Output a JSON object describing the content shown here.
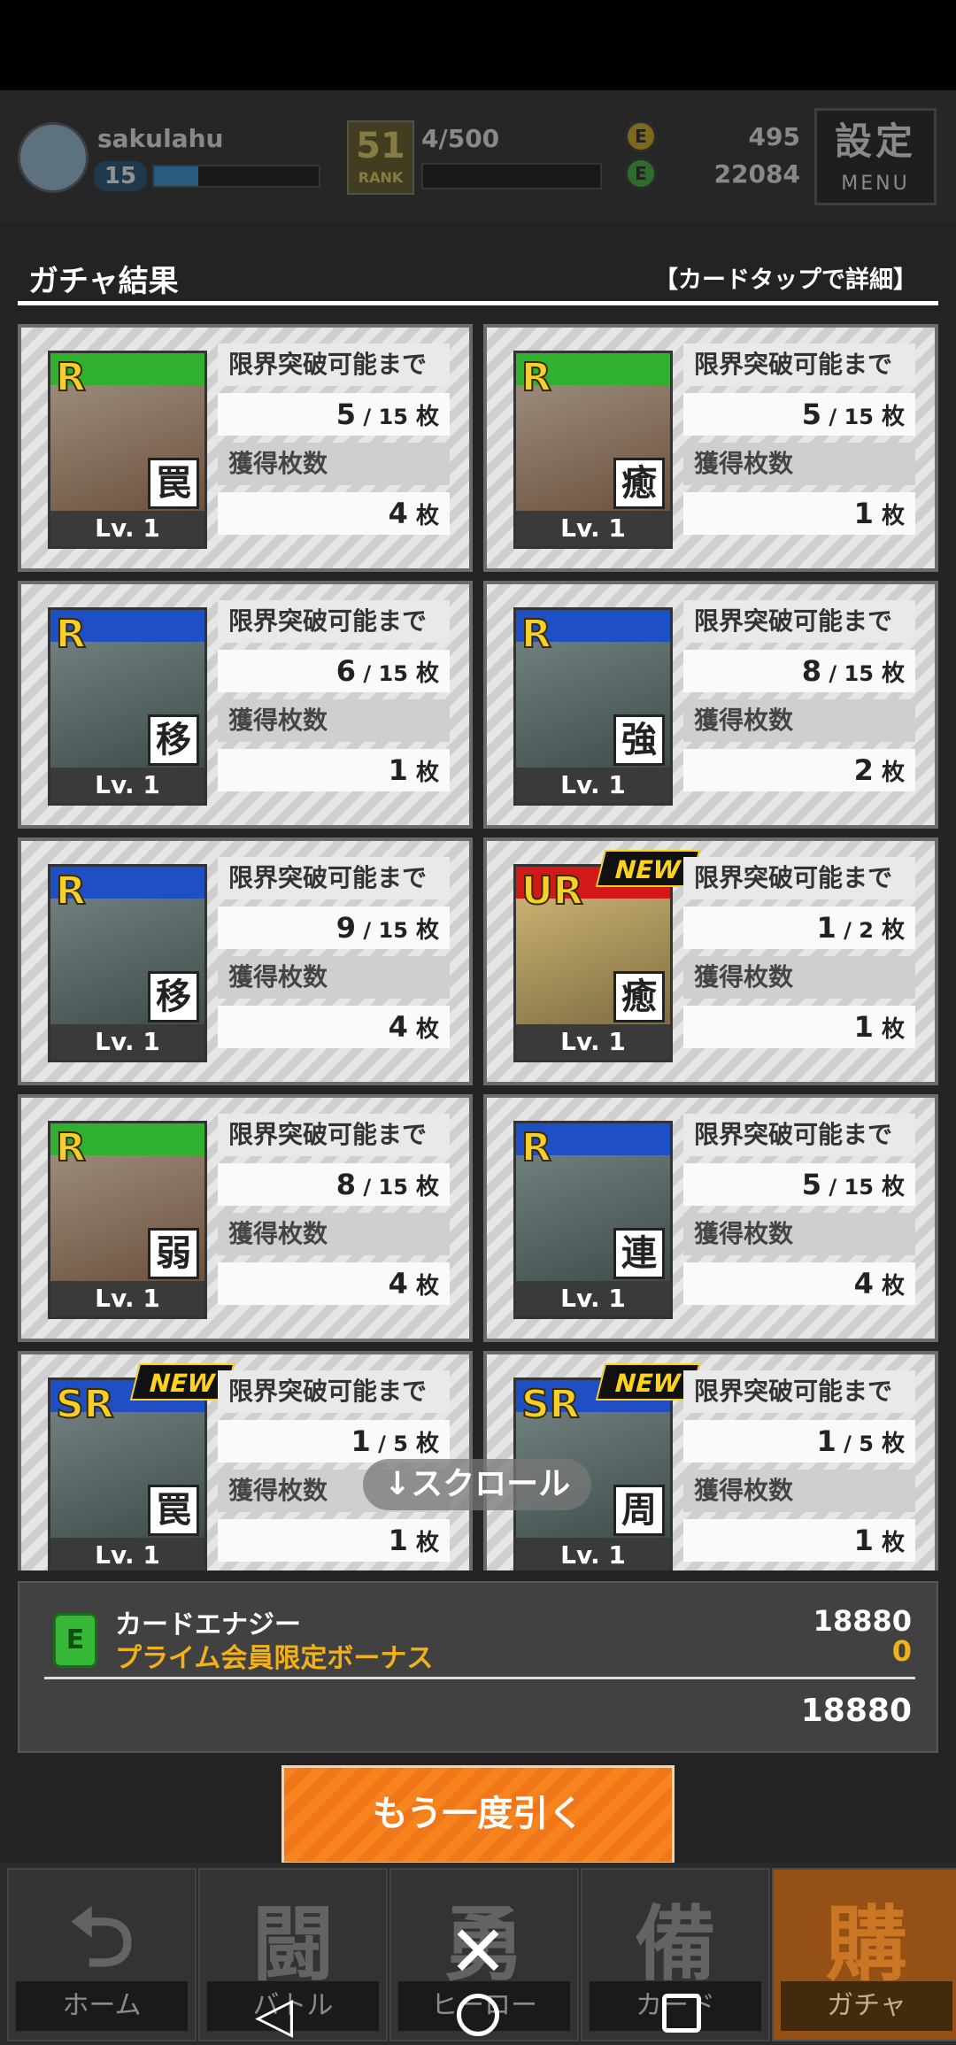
{
  "header": {
    "username": "sakulahu",
    "level": "15",
    "rank": "51",
    "rank_label": "RANK",
    "rank_count": "4/500",
    "coin_yellow_icon": "E",
    "coin_green_icon": "E",
    "currency_yellow": "495",
    "currency_green": "22084",
    "menu_big": "設定",
    "menu_small": "MENU"
  },
  "title": {
    "text": "ガチャ結果",
    "hint": "【カードタップで詳細】"
  },
  "labels": {
    "limit": "限界突破可能まで",
    "obtained": "獲得枚数",
    "unit": "枚",
    "lv": "Lv. 1",
    "new": "NEW"
  },
  "cards": [
    {
      "rarity": "R",
      "band": "green",
      "kanji": "罠",
      "limit": "5 / 15",
      "count": "4",
      "is_new": false
    },
    {
      "rarity": "R",
      "band": "green",
      "kanji": "癒",
      "limit": "5 / 15",
      "count": "1",
      "is_new": false
    },
    {
      "rarity": "R",
      "band": "blue",
      "kanji": "移",
      "limit": "6 / 15",
      "count": "1",
      "is_new": false
    },
    {
      "rarity": "R",
      "band": "blue",
      "kanji": "強",
      "limit": "8 / 15",
      "count": "2",
      "is_new": false
    },
    {
      "rarity": "R",
      "band": "blue",
      "kanji": "移",
      "limit": "9 / 15",
      "count": "4",
      "is_new": false
    },
    {
      "rarity": "UR",
      "band": "red",
      "kanji": "癒",
      "limit": "1 / 2",
      "count": "1",
      "is_new": true
    },
    {
      "rarity": "R",
      "band": "green",
      "kanji": "弱",
      "limit": "8 / 15",
      "count": "4",
      "is_new": false
    },
    {
      "rarity": "R",
      "band": "blue",
      "kanji": "連",
      "limit": "5 / 15",
      "count": "4",
      "is_new": false
    },
    {
      "rarity": "SR",
      "band": "blue",
      "kanji": "罠",
      "limit": "1 / 5",
      "count": "1",
      "is_new": true
    },
    {
      "rarity": "SR",
      "band": "blue",
      "kanji": "周",
      "limit": "1 / 5",
      "count": "1",
      "is_new": true
    }
  ],
  "scroll_hint": "↓スクロール",
  "energy": {
    "label": "カードエナジー",
    "bonus_label": "プライム会員限定ボーナス",
    "value": "18880",
    "bonus_value": "0",
    "total": "18880",
    "icon": "E"
  },
  "again_button": "もう一度引く",
  "nav": [
    {
      "kanji": "⮌",
      "label": "ホーム",
      "active": false
    },
    {
      "kanji": "闘",
      "label": "バトル",
      "active": false
    },
    {
      "kanji": "勇",
      "label": "ヒーロー",
      "active": false
    },
    {
      "kanji": "備",
      "label": "カード",
      "active": false
    },
    {
      "kanji": "購",
      "label": "ガチャ",
      "active": true
    }
  ],
  "close_symbol": "✕",
  "colors": {
    "accent_orange": "#f7831c",
    "bonus_yellow": "#f2b118",
    "rarity_gold": "#f5d02c"
  }
}
